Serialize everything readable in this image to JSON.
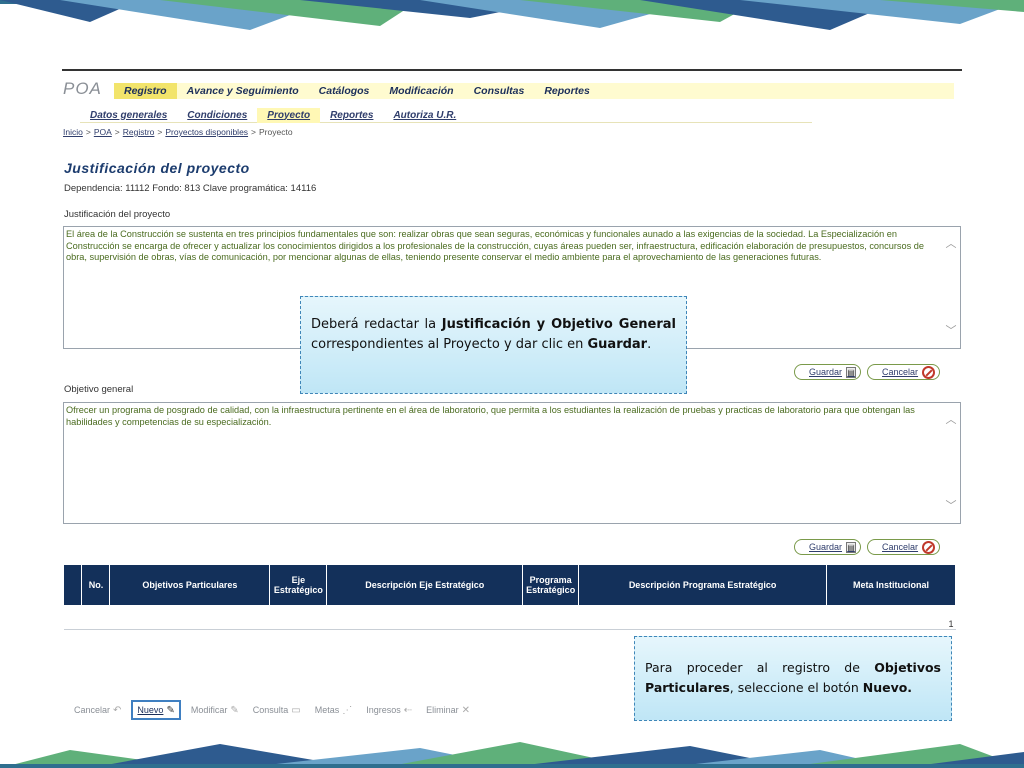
{
  "app": {
    "logo": "POA"
  },
  "menu": {
    "items": [
      "Registro",
      "Avance y Seguimiento",
      "Catálogos",
      "Modificación",
      "Consultas",
      "Reportes"
    ],
    "active_index": 0
  },
  "submenu": {
    "items": [
      "Datos generales",
      "Condiciones",
      "Proyecto",
      "Reportes",
      "Autoriza U.R."
    ],
    "active_index": 2
  },
  "breadcrumb": {
    "links": [
      "Inicio",
      "POA",
      "Registro",
      "Proyectos disponibles"
    ],
    "separator": ">",
    "current": "Proyecto"
  },
  "page": {
    "title": "Justificación del proyecto",
    "meta": "Dependencia:  11112 Fondo: 813 Clave programática: 14116"
  },
  "justificacion": {
    "label": "Justificación del proyecto",
    "text": "El área de la Construcción se sustenta en tres principios fundamentales que son: realizar obras que sean seguras, económicas y funcionales aunado a las exigencias de la sociedad. La Especialización en Construcción se encarga de ofrecer y actualizar los conocimientos dirigidos a los profesionales de la construcción, cuyas áreas pueden ser, infraestructura, edificación elaboración de presupuestos, concursos de obra, supervisión de obras, vías de comunicación, por mencionar algunas de ellas, teniendo presente conservar el medio ambiente para el aprovechamiento de las generaciones futuras."
  },
  "objetivo": {
    "label": "Objetivo general",
    "text": "Ofrecer un programa de posgrado de calidad, con la infraestructura pertinente en el área de laboratorio, que permita a los estudiantes la realización de pruebas y practicas de laboratorio para que obtengan las habilidades y competencias de su especialización."
  },
  "buttons": {
    "save": "Guardar",
    "cancel": "Cancelar"
  },
  "table": {
    "headers": [
      "",
      "No.",
      "Objetivos Particulares",
      "Eje Estratégico",
      "Descripción Eje Estratégico",
      "Programa Estratégico",
      "Descripción Programa Estratégico",
      "Meta Institucional"
    ],
    "page_number": "1"
  },
  "actions": [
    {
      "label": "Cancelar",
      "icon": "undo-icon",
      "glyph": "↶",
      "enabled": false
    },
    {
      "label": "Nuevo",
      "icon": "new-doc-icon",
      "glyph": "✎",
      "enabled": true
    },
    {
      "label": "Modificar",
      "icon": "edit-icon",
      "glyph": "✎",
      "enabled": false
    },
    {
      "label": "Consulta",
      "icon": "view-icon",
      "glyph": "▭",
      "enabled": false
    },
    {
      "label": "Metas",
      "icon": "goals-icon",
      "glyph": "⋰",
      "enabled": false
    },
    {
      "label": "Ingresos",
      "icon": "income-icon",
      "glyph": "⇠",
      "enabled": false
    },
    {
      "label": "Eliminar",
      "icon": "delete-icon",
      "glyph": "✕",
      "enabled": false
    }
  ],
  "callouts": {
    "first": {
      "t1": "Deberá redactar la ",
      "b1": "Justificación y Objetivo General",
      "t2": " correspondientes al Proyecto y dar clic en ",
      "b2": "Guardar",
      "t3": "."
    },
    "second": {
      "t1": "Para proceder al registro de ",
      "b1": "Objetivos Particulares",
      "t2": ", seleccione el botón ",
      "b2": "Nuevo.",
      "t3": ""
    }
  },
  "colors": {
    "header_navy": "#13305a",
    "menu_bg": "#fffbd0",
    "menu_active": "#f2e46b",
    "text_green": "#4a6b1f",
    "callout_border": "#3f86b8"
  }
}
